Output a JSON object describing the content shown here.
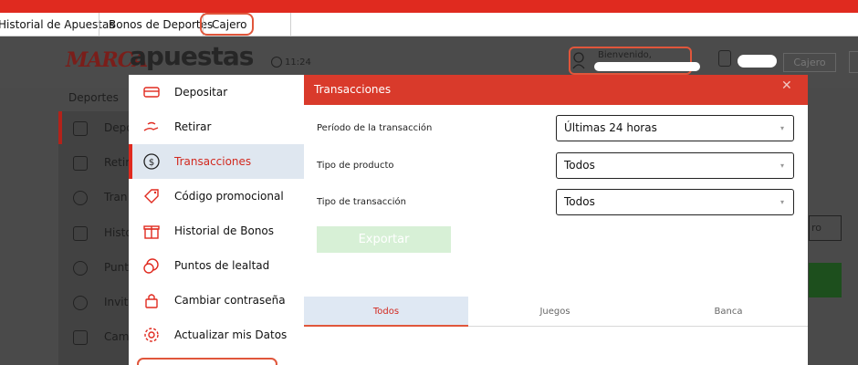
{
  "nav": {
    "items": [
      "Historial de Apuestas",
      "Bonos de Deportes",
      "Cajero"
    ]
  },
  "header": {
    "logo_marca": "MARCA",
    "logo_apuestas": "apuestas",
    "time": "11:24",
    "welcome": "Bienvenido,",
    "cajero_button": "Cajero"
  },
  "background": {
    "deportes": "Deportes",
    "sidebar": [
      "Depo",
      "Retir",
      "Tran",
      "Histo",
      "Punt",
      "Invit",
      "Cam"
    ],
    "right_button": "ro"
  },
  "menu": {
    "items": [
      {
        "label": "Depositar",
        "icon": "card-icon"
      },
      {
        "label": "Retirar",
        "icon": "hand-money-icon"
      },
      {
        "label": "Transacciones",
        "icon": "dollar-cycle-icon"
      },
      {
        "label": "Código promocional",
        "icon": "tag-icon"
      },
      {
        "label": "Historial de Bonos",
        "icon": "gift-icon"
      },
      {
        "label": "Puntos de lealtad",
        "icon": "coins-icon"
      },
      {
        "label": "Cambiar contraseña",
        "icon": "lock-icon"
      },
      {
        "label": "Actualizar mis Datos",
        "icon": "gear-icon"
      }
    ],
    "active_index": 2
  },
  "panel": {
    "title": "Transacciones",
    "close": "✕",
    "fields": [
      {
        "label": "Período de la transacción",
        "value": "Últimas 24 horas"
      },
      {
        "label": "Tipo de producto",
        "value": "Todos"
      },
      {
        "label": "Tipo de transacción",
        "value": "Todos"
      }
    ],
    "export": "Exportar",
    "tabs": [
      "Todos",
      "Juegos",
      "Banca"
    ],
    "active_tab": 0
  },
  "colors": {
    "accent_red": "#e02a1f",
    "header_red": "#d93a2b",
    "highlight_orange": "#e0563b",
    "export_green": "#d7f0d6",
    "active_bg": "#dfe7f0"
  }
}
